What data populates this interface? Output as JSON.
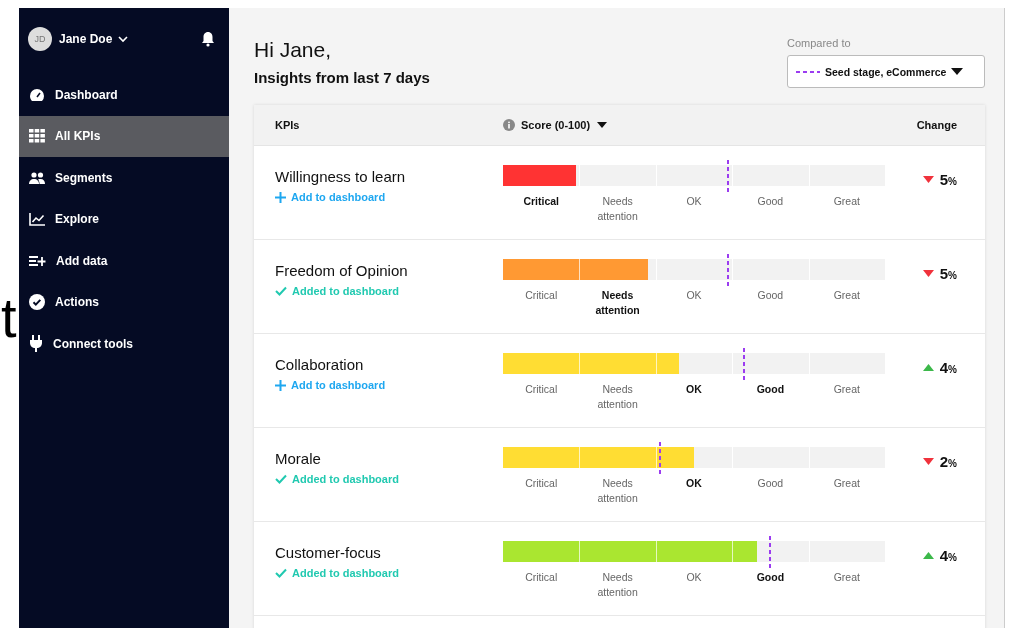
{
  "slide_text": [
    "t"
  ],
  "user": {
    "initials": "JD",
    "name": "Jane Doe"
  },
  "sidebar": {
    "items": [
      {
        "label": "Dashboard",
        "selected": false
      },
      {
        "label": "All KPIs",
        "selected": true
      },
      {
        "label": "Segments",
        "selected": false
      },
      {
        "label": "Explore",
        "selected": false
      },
      {
        "label": "Add data",
        "selected": false
      },
      {
        "label": "Actions",
        "selected": false
      },
      {
        "label": "Connect tools",
        "selected": false
      }
    ]
  },
  "greeting": "Hi Jane,",
  "subtitle": "Insights from last 7 days",
  "compare": {
    "label": "Compared to",
    "value": "Seed stage, eCommerce"
  },
  "table": {
    "columns": [
      "KPIs",
      "Score (0-100)",
      "Change"
    ],
    "rows": [
      {
        "name": "Willingness to learn",
        "added": false,
        "dashboard_text": "Add to dashboard",
        "score": {
          "level": 0.19,
          "color": "#ff3333"
        },
        "benchmark": {
          "level": 0.59
        },
        "bands": [
          {
            "label": "Critical",
            "selected": true
          },
          {
            "label": "Needs attention",
            "selected": false
          },
          {
            "label": "OK",
            "selected": false
          },
          {
            "label": "Good",
            "selected": false
          },
          {
            "label": "Great",
            "selected": false
          }
        ],
        "kind": "down",
        "change": "5",
        "unit": "%"
      },
      {
        "name": "Freedom of Opinion",
        "added": true,
        "dashboard_text": "Added to dashboard",
        "score": {
          "level": 0.38,
          "color": "#ff9933"
        },
        "benchmark": {
          "level": 0.59
        },
        "bands": [
          {
            "label": "Critical",
            "selected": false
          },
          {
            "label": "Needs attention",
            "selected": true
          },
          {
            "label": "OK",
            "selected": false
          },
          {
            "label": "Good",
            "selected": false
          },
          {
            "label": "Great",
            "selected": false
          }
        ],
        "kind": "down",
        "change": "5",
        "unit": "%"
      },
      {
        "name": "Collaboration",
        "added": false,
        "dashboard_text": "Add to dashboard",
        "score": {
          "level": 0.46,
          "color": "#ffdd33"
        },
        "benchmark": {
          "level": 0.63
        },
        "bands": [
          {
            "label": "Critical",
            "selected": false
          },
          {
            "label": "Needs attention",
            "selected": false
          },
          {
            "label": "OK",
            "selected": true
          },
          {
            "label": "Good",
            "selected": true
          },
          {
            "label": "Great",
            "selected": false
          }
        ],
        "kind": "up",
        "change": "4",
        "unit": "%"
      },
      {
        "name": "Morale",
        "added": true,
        "dashboard_text": "Added to dashboard",
        "score": {
          "level": 0.5,
          "color": "#ffdd33"
        },
        "benchmark": {
          "level": 0.41
        },
        "bands": [
          {
            "label": "Critical",
            "selected": false
          },
          {
            "label": "Needs attention",
            "selected": false
          },
          {
            "label": "OK",
            "selected": true
          },
          {
            "label": "Good",
            "selected": false
          },
          {
            "label": "Great",
            "selected": false
          }
        ],
        "kind": "down",
        "change": "2",
        "unit": "%"
      },
      {
        "name": "Customer-focus",
        "added": true,
        "dashboard_text": "Added to dashboard",
        "score": {
          "level": 0.665,
          "color": "#aae630"
        },
        "benchmark": {
          "level": 0.7
        },
        "bands": [
          {
            "label": "Critical",
            "selected": false
          },
          {
            "label": "Needs attention",
            "selected": false
          },
          {
            "label": "OK",
            "selected": false
          },
          {
            "label": "Good",
            "selected": true
          },
          {
            "label": "Great",
            "selected": false
          }
        ],
        "kind": "up",
        "change": "4",
        "unit": "%"
      }
    ]
  }
}
